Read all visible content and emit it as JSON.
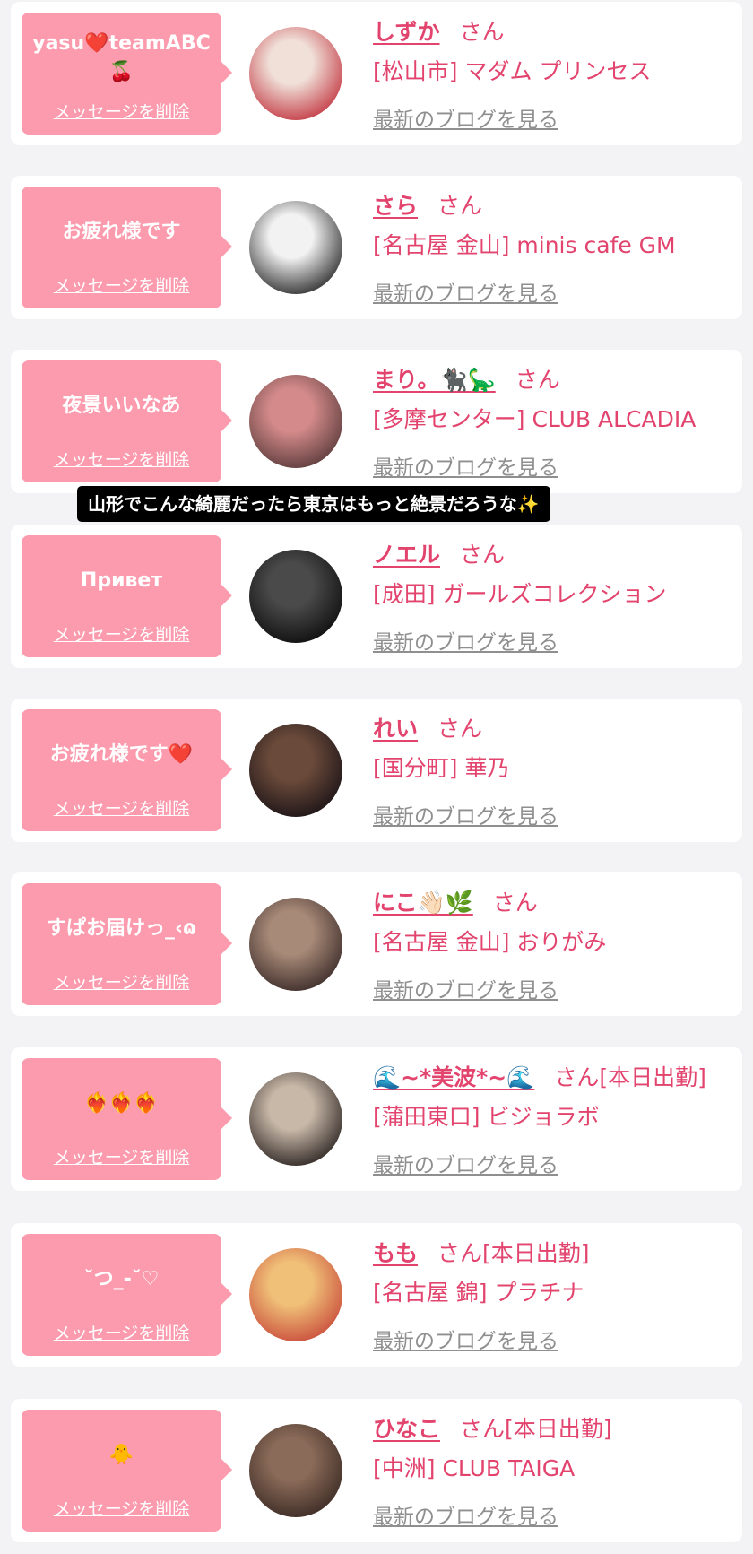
{
  "delete_label": "メッセージを削除",
  "blog_label": "最新のブログを見る",
  "san_label": "さん",
  "colors": {
    "bubble": "#fb9bad",
    "accent": "#e2446e",
    "link_gray": "#8f8f8f",
    "page_background": "#f3f3f5"
  },
  "comment_overlay": "山形でこんな綺麗だったら東京はもっと絶景だろうな✨",
  "messages": [
    {
      "message": "yasu❤️teamABC🍒",
      "name": "しずか",
      "san": "さん",
      "shop": "[松山市] マダム プリンセス",
      "avatar_colors": [
        "#f0e0d8",
        "#c23540"
      ]
    },
    {
      "message": "お疲れ様です",
      "name": "さら",
      "san": "さん",
      "shop": "[名古屋 金山] minis cafe GM",
      "avatar_colors": [
        "#f2f2f2",
        "#2a2a2a"
      ]
    },
    {
      "message": "夜景いいなあ",
      "name": "まり。🐈‍⬛🦕",
      "san": "さん",
      "shop": "[多摩センター] CLUB ALCADIA",
      "avatar_colors": [
        "#d48a8a",
        "#5a3a3a"
      ]
    },
    {
      "message": "Привет",
      "name": "ノエル",
      "san": "さん",
      "shop": "[成田] ガールズコレクション",
      "avatar_colors": [
        "#4a4a4a",
        "#0d0d0d"
      ]
    },
    {
      "message": "お疲れ様です❤️",
      "name": "れい",
      "san": "さん",
      "shop": "[国分町] 華乃",
      "avatar_colors": [
        "#6a4a3a",
        "#1a1216"
      ]
    },
    {
      "message": "すぱお届けっ_‹ɷ",
      "name": "にこ👋🏻🌿",
      "san": "さん",
      "shop": "[名古屋 金山] おりがみ",
      "avatar_colors": [
        "#a88a78",
        "#3a2a28"
      ]
    },
    {
      "message": "❤️‍🔥❤️‍🔥❤️‍🔥",
      "name": "🌊~*美波*~🌊",
      "san": "さん[本日出勤]",
      "shop": "[蒲田東口] ビジョラボ",
      "avatar_colors": [
        "#c8b8a8",
        "#2a2220"
      ]
    },
    {
      "message": "˘つ_-˘♡",
      "name": "もも",
      "san": "さん[本日出勤]",
      "shop": "[名古屋 錦] プラチナ",
      "avatar_colors": [
        "#f0c078",
        "#c84a3a"
      ]
    },
    {
      "message": "🐥",
      "name": "ひなこ",
      "san": "さん[本日出勤]",
      "shop": "[中洲] CLUB TAIGA",
      "avatar_colors": [
        "#8a6a58",
        "#3a2a24"
      ]
    }
  ]
}
